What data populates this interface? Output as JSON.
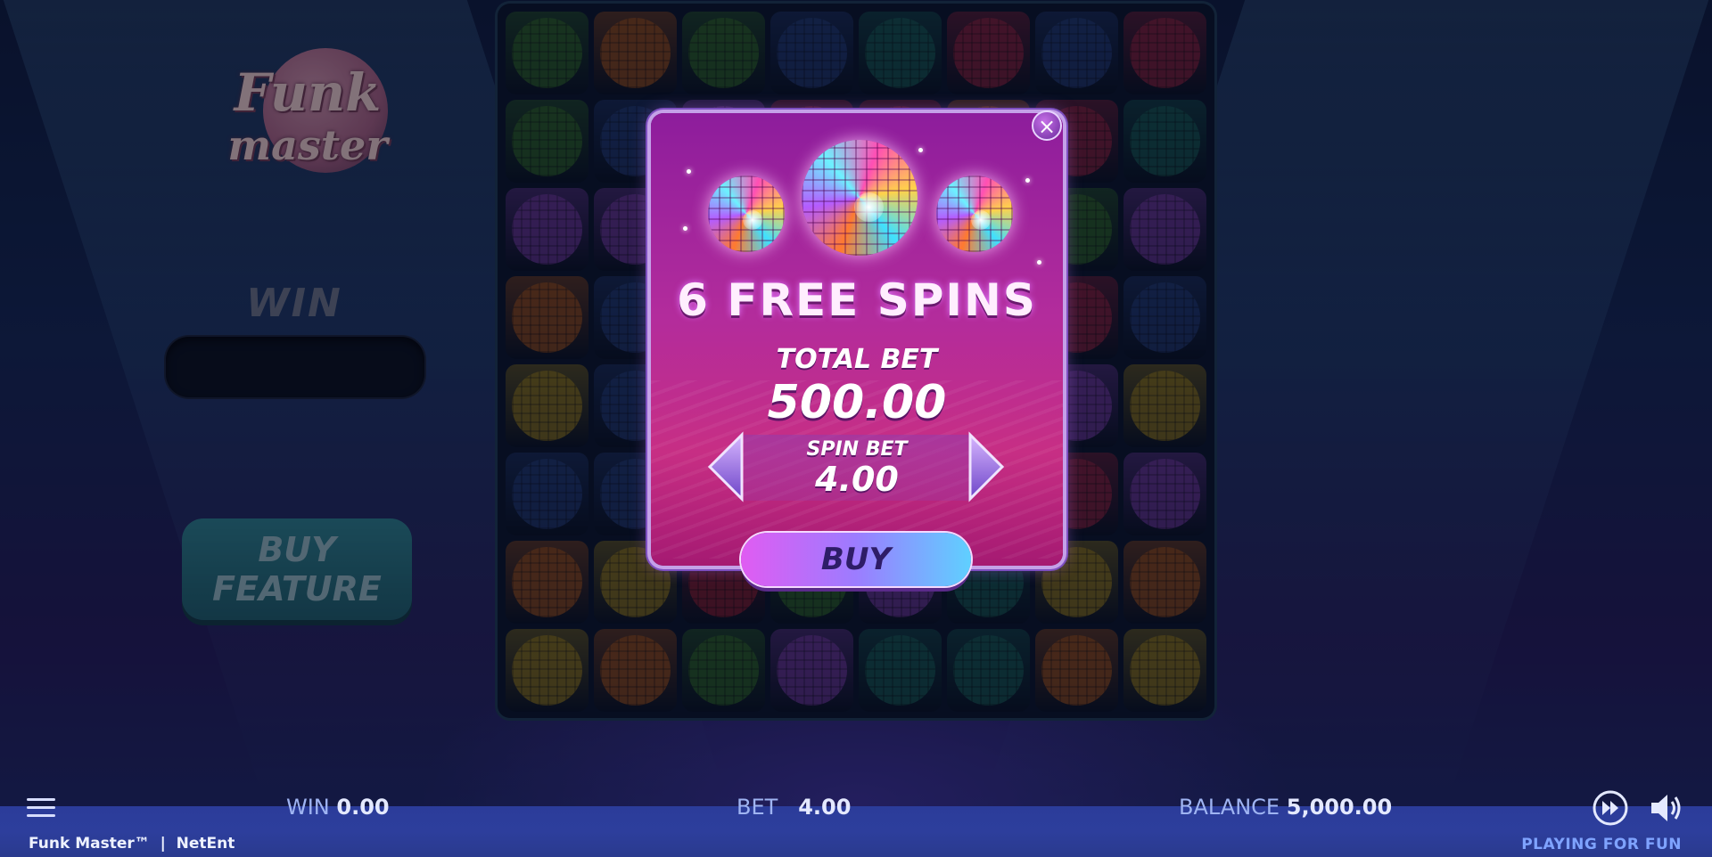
{
  "left_panel": {
    "logo_line1": "Funk",
    "logo_line2": "master",
    "win_label": "WIN",
    "win_value": "",
    "buy_feature_line1": "BUY",
    "buy_feature_line2": "FEATURE"
  },
  "reels": {
    "symbols": [
      [
        "green",
        "green",
        "purple",
        "orange",
        "yellow",
        "blue",
        "orange",
        "yellow"
      ],
      [
        "orange",
        "blue",
        "purple",
        "blue",
        "blue",
        "blue",
        "yellow",
        "orange"
      ],
      [
        "green",
        "purple",
        "purple",
        "blue",
        "blue",
        "blue",
        "red-multiplier",
        "green"
      ],
      [
        "blue",
        "red",
        "purple",
        "blue",
        "blue",
        "blue",
        "green",
        "purple"
      ],
      [
        "teal",
        "red-multiplier",
        "purple",
        "blue",
        "blue",
        "purple",
        "purple",
        "teal"
      ],
      [
        "red",
        "orange",
        "purple",
        "blue",
        "blue",
        "purple",
        "teal",
        "teal"
      ],
      [
        "blue",
        "red",
        "green",
        "red",
        "purple",
        "red",
        "yellow",
        "orange"
      ],
      [
        "red",
        "teal",
        "purple",
        "blue",
        "yellow",
        "purple",
        "orange",
        "yellow"
      ]
    ]
  },
  "modal": {
    "title": "6 FREE SPINS",
    "total_bet_label": "TOTAL BET",
    "total_bet_value": "500.00",
    "spin_bet_label": "SPIN BET",
    "spin_bet_value": "4.00",
    "buy_label": "BUY",
    "close_symbol": "×"
  },
  "bottom_bar": {
    "win_label": "WIN",
    "win_value": "0.00",
    "bet_label": "BET",
    "bet_value": "4.00",
    "balance_label": "BALANCE",
    "balance_value": "5,000.00",
    "game_name": "Funk Master™",
    "provider": "NetEnt",
    "mode": "PLAYING FOR FUN"
  },
  "colors": {
    "green": "#3f8a2c",
    "orange": "#d46a1a",
    "yellow": "#c9a41a",
    "purple": "#9a4bd0",
    "blue": "#2e4f9a",
    "red": "#c22a4a",
    "teal": "#1d7a6a",
    "red-multiplier": "#c0253a"
  },
  "icons": {
    "menu": "hamburger-icon",
    "fast_forward": "fast-forward-icon",
    "sound": "speaker-icon",
    "prev": "chevron-left-icon",
    "next": "chevron-right-icon",
    "close": "close-icon"
  }
}
